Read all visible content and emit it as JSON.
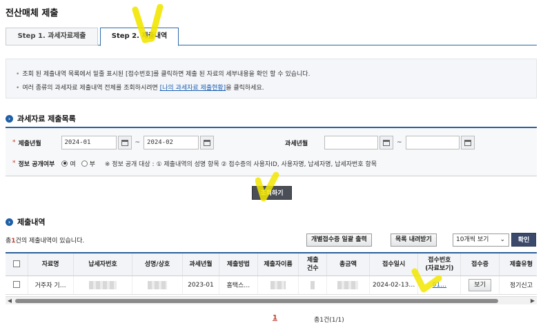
{
  "page": {
    "title": "전산매체 제출"
  },
  "tabs": [
    {
      "label": "Step 1. 과세자료제출"
    },
    {
      "label": "Step 2. 제출내역"
    }
  ],
  "notice": {
    "line1": "조회 된 제출내역 목록에서 밑줄 표시된 [접수번호]를 클릭하면 제출 된 자료의 세부내용을 확인 할 수 있습니다.",
    "line2_pre": "여러 종류의 과세자료 제출내역 전체를 조회하시려면 ",
    "line2_link": "[나의 과세자료 제출현황]",
    "line2_post": "을 클릭하세요."
  },
  "search_section": {
    "title": "과세자료 제출목록",
    "submit_period_label": "제출년월",
    "submit_from": "2024-01",
    "submit_to": "2024-02",
    "tax_period_label": "과세년월",
    "tax_from": "",
    "tax_to": "",
    "disclosure_label": "정보 공개여부",
    "yes": "여",
    "no": "부",
    "disclosure_note": "※ 정보 공개 대상 : ① 제출내역의 성명 항목 ② 접수증의 사용자ID, 사용자명, 납세자명, 납세자번호 항목",
    "tilde": "~",
    "search_button": "조회하기"
  },
  "result_section": {
    "title": "제출내역",
    "count_pre": "총",
    "count": "1",
    "count_post": "건의 제출내역이 있습니다.",
    "print_button": "개별접수증 일괄 출력",
    "download_button": "목록 내려받기",
    "page_size": "10개씩 보기",
    "confirm_button": "확인"
  },
  "table": {
    "headers": [
      "자료명",
      "납세자번호",
      "성명/상호",
      "과세년월",
      "제출방법",
      "제출자이름",
      "제출\n건수",
      "총금액",
      "접수일시",
      "접수번호\n(자료보기)",
      "접수증",
      "제출유형"
    ],
    "rows": [
      {
        "name": "거주자 기…",
        "tax_period": "2023-01",
        "method": "홈택스…",
        "received": "2024-02-13…",
        "receipt_no": "01…",
        "view": "보기",
        "type": "정기신고"
      }
    ]
  },
  "pagination": {
    "current": "1",
    "total": "총1건(1/1)"
  }
}
